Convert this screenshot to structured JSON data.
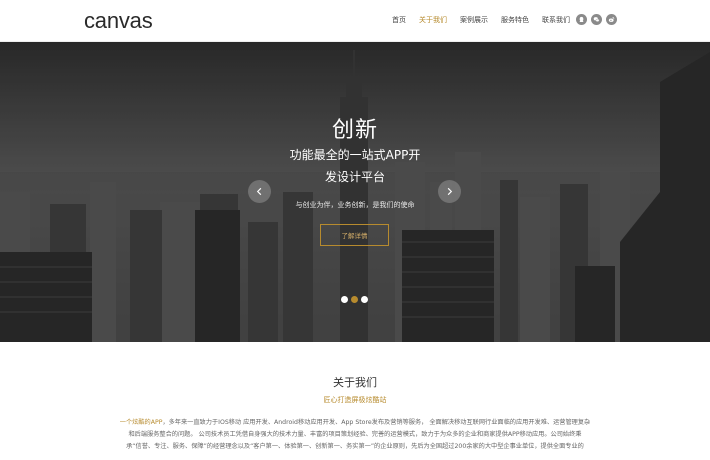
{
  "header": {
    "logo": "canvas",
    "nav": [
      "首页",
      "关于我们",
      "案例展示",
      "服务特色",
      "联系我们"
    ],
    "active_nav": 1,
    "social": [
      "qq-icon",
      "wechat-icon",
      "weibo-icon"
    ]
  },
  "hero": {
    "title": "创新",
    "subtitle_line1": "功能最全的一站式APP开",
    "subtitle_line2": "发设计平台",
    "tagline": "与创业为伴，业务创新，是我们的使命",
    "button": "了解详情",
    "slides": 3,
    "active_slide": 1
  },
  "about": {
    "title": "关于我们",
    "subtitle": "匠心打造屏极炫酷站",
    "highlight": "一个炫酷的APP",
    "line1": "，多年来一直致力于IOS移动 应用开发、Android移动应用开发、App Store发布及营销等服务， 全面解决移动互联网行业面临的应用开发难、运营管理复杂",
    "line2": "和后端服务整合的问题。    公司技术员工凭借自身强大的技术力量、丰富的项目策划经验、完善的运营模式，致力于为众多的企业和商家提供APP移动应用。公司始终秉",
    "line3": "承“信誉、专注、服务、保障”的经营理念以及“客户第一、体验第一、创新第一、务实第一”的企业原则，先后为全国超过200余家的大中型企事业单位，提供全面专业的"
  },
  "colors": {
    "accent": "#b78b2e",
    "header_bg": "#ffffff",
    "hero_bg": "#3a3a3a"
  }
}
